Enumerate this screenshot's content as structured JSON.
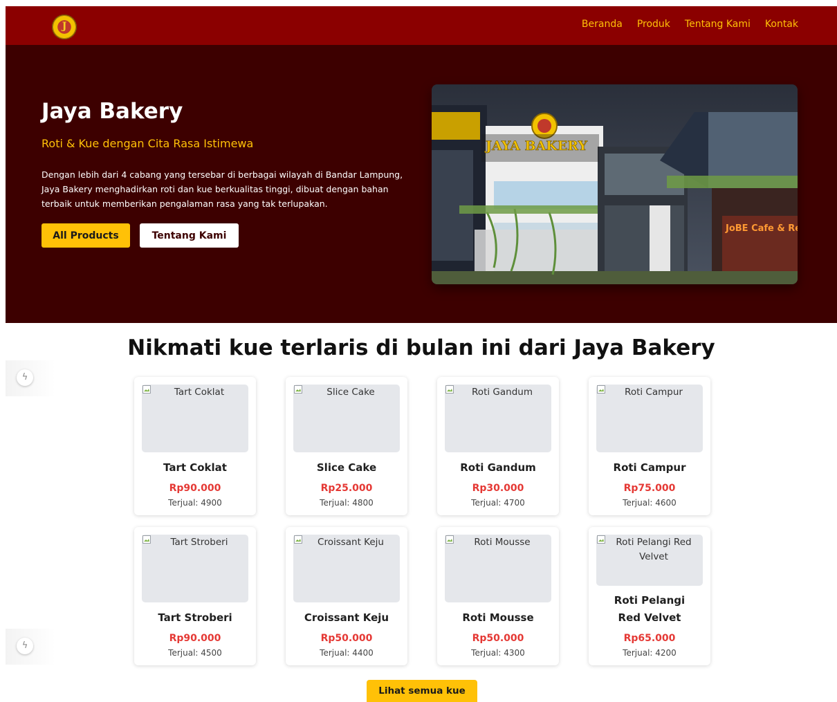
{
  "navbar": {
    "logo_letter": "J",
    "links": [
      "Beranda",
      "Produk",
      "Tentang Kami",
      "Kontak"
    ]
  },
  "hero": {
    "title": "Jaya Bakery",
    "subtitle": "Roti & Kue dengan Cita Rasa Istimewa",
    "description": "Dengan lebih dari 4 cabang yang tersebar di berbagai wilayah di Bandar Lampung, Jaya Bakery menghadirkan roti dan kue berkualitas tinggi, dibuat dengan bahan terbaik untuk memberikan pengalaman rasa yang tak terlupakan.",
    "btn_primary": "All Products",
    "btn_secondary": "Tentang Kami",
    "photo_sign": "JAYA BAKERY",
    "photo_sign_secondary": "JoBE Cafe & Re"
  },
  "section": {
    "title": "Nikmati kue terlaris di bulan ini dari Jaya Bakery",
    "products": [
      {
        "alt": "Tart Coklat",
        "name": "Tart Coklat",
        "price": "Rp90.000",
        "sold": "Terjual: 4900"
      },
      {
        "alt": "Slice Cake",
        "name": "Slice Cake",
        "price": "Rp25.000",
        "sold": "Terjual: 4800"
      },
      {
        "alt": "Roti Gandum",
        "name": "Roti Gandum",
        "price": "Rp30.000",
        "sold": "Terjual: 4700"
      },
      {
        "alt": "Roti Campur",
        "name": "Roti Campur",
        "price": "Rp75.000",
        "sold": "Terjual: 4600"
      },
      {
        "alt": "Tart Stroberi",
        "name": "Tart Stroberi",
        "price": "Rp90.000",
        "sold": "Terjual: 4500"
      },
      {
        "alt": "Croissant Keju",
        "name": "Croissant Keju",
        "price": "Rp50.000",
        "sold": "Terjual: 4400"
      },
      {
        "alt": "Roti Mousse",
        "name": "Roti Mousse",
        "price": "Rp50.000",
        "sold": "Terjual: 4300"
      },
      {
        "alt": "Roti Pelangi Red Velvet",
        "name": "Roti Pelangi Red Velvet",
        "price": "Rp65.000",
        "sold": "Terjual: 4200"
      }
    ],
    "more_button": "Lihat semua kue"
  },
  "side_button_icon": "lightning-icon",
  "colors": {
    "navbar": "#8b0000",
    "hero": "#3d0000",
    "accent": "#ffc107",
    "price": "#e53935"
  }
}
